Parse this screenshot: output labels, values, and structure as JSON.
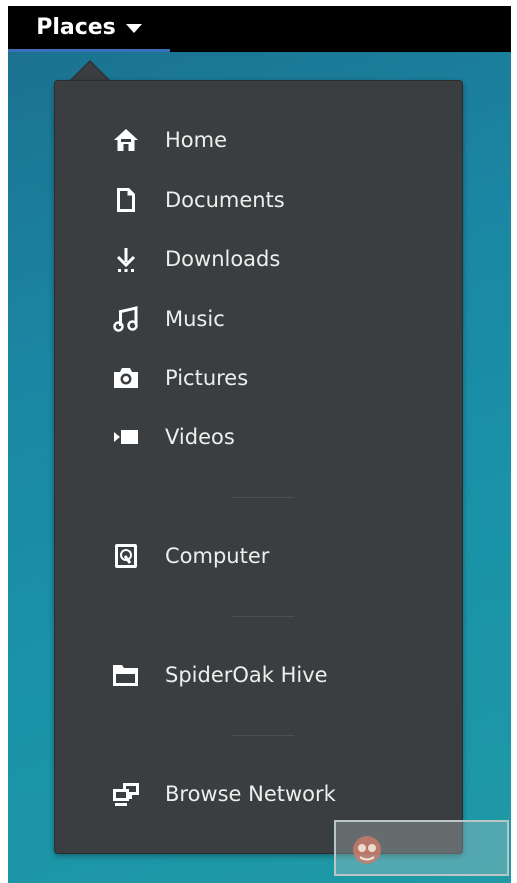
{
  "topbar": {
    "places_label": "Places"
  },
  "menu": {
    "items": [
      {
        "label": "Home",
        "icon": "home-icon"
      },
      {
        "label": "Documents",
        "icon": "document-icon"
      },
      {
        "label": "Downloads",
        "icon": "download-icon"
      },
      {
        "label": "Music",
        "icon": "music-icon"
      },
      {
        "label": "Pictures",
        "icon": "camera-icon"
      },
      {
        "label": "Videos",
        "icon": "video-icon"
      },
      {
        "label": "Computer",
        "icon": "harddisk-icon"
      },
      {
        "label": "SpiderOak Hive",
        "icon": "folder-icon"
      },
      {
        "label": "Browse Network",
        "icon": "network-icon"
      }
    ]
  },
  "colors": {
    "topbar": "#000000",
    "menu_background": "#3a3e40",
    "menu_text": "#eeeeec",
    "active_underline": "#3a6fbd",
    "desktop": "#1b86a3"
  }
}
